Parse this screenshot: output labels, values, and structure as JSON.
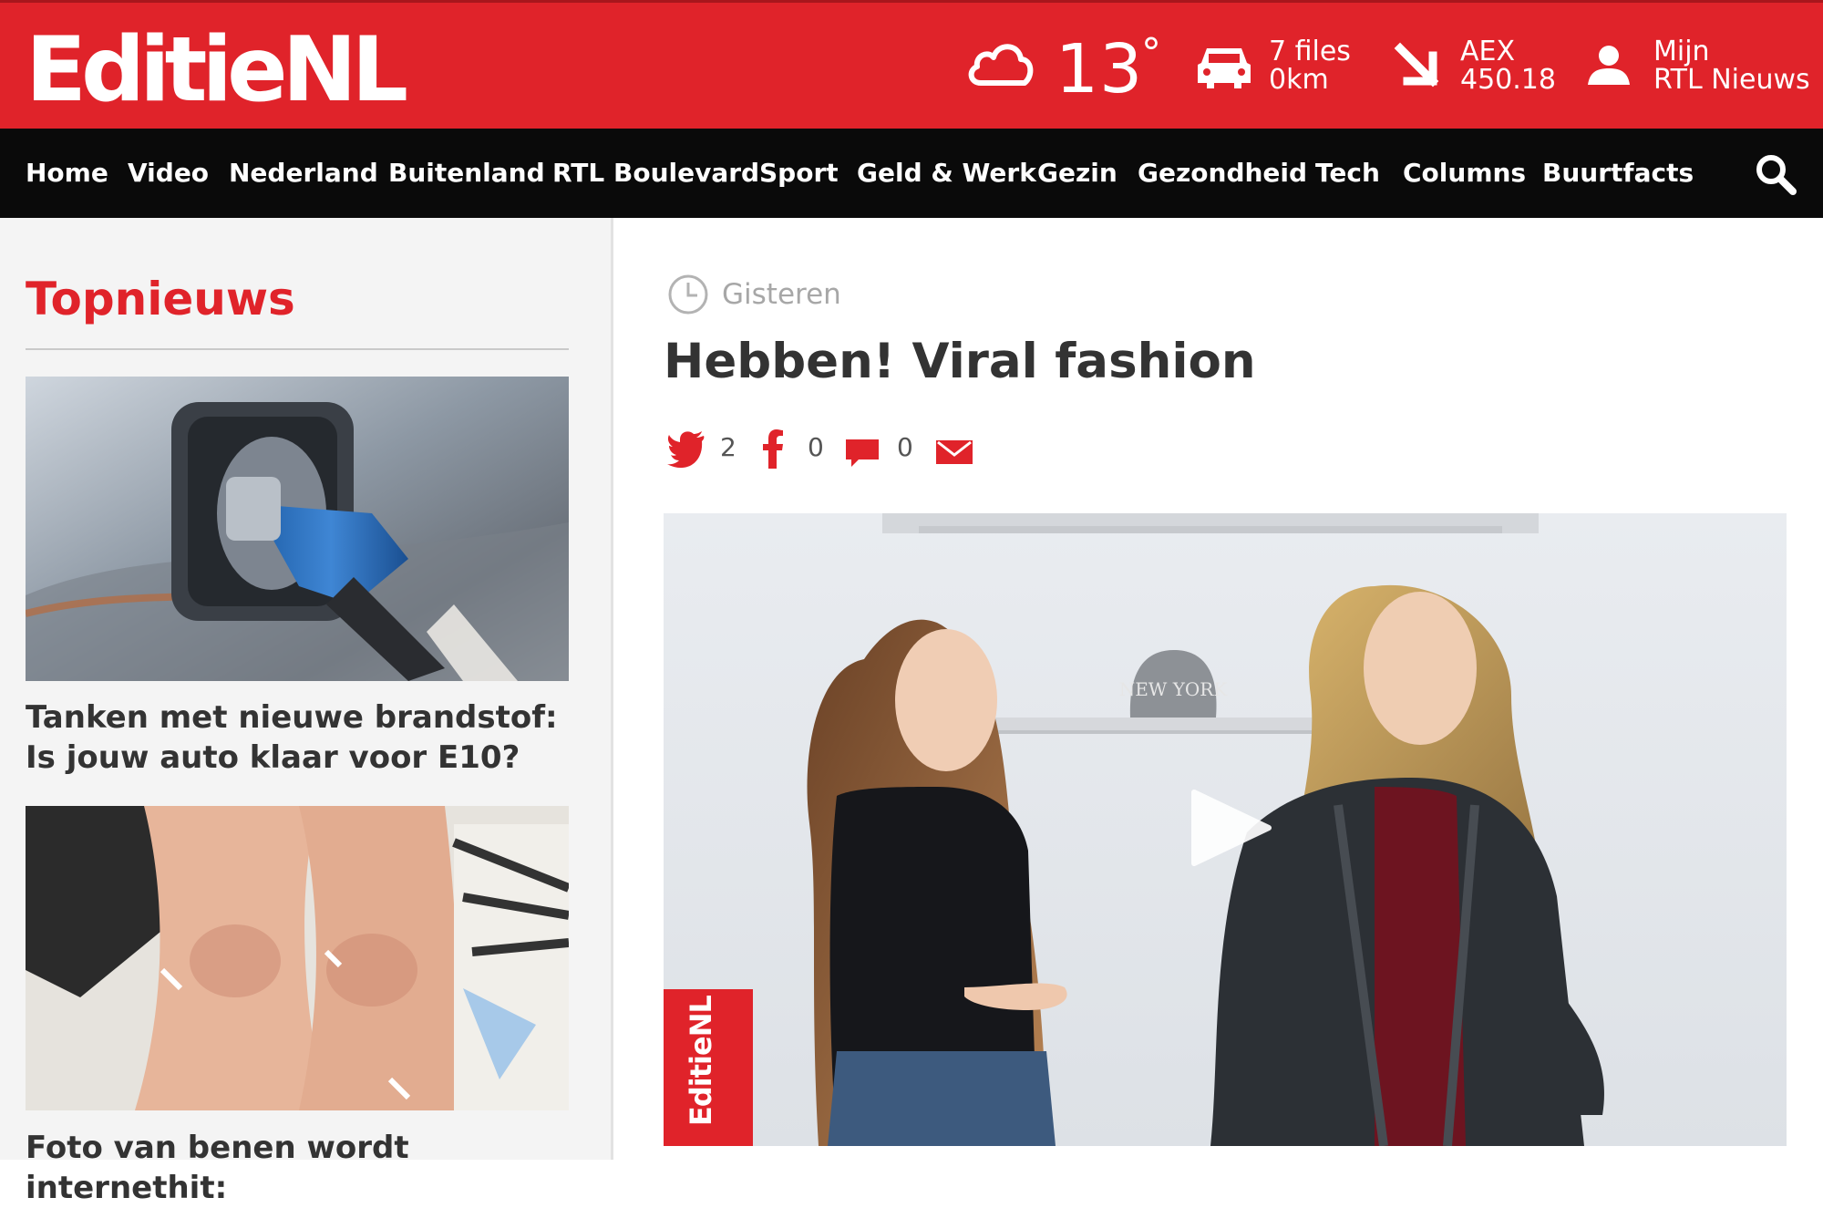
{
  "brand": {
    "logo_text": "EditieNL",
    "primary_color": "#e0232a",
    "nav_background": "#0a0a0a"
  },
  "header": {
    "weather": {
      "icon": "cloud-icon",
      "temperature": "13",
      "degree_symbol": "°"
    },
    "traffic": {
      "icon": "car-icon",
      "line1": "7 files",
      "line2": "0km"
    },
    "stocks": {
      "icon": "arrow-down-right-icon",
      "line1": "AEX",
      "line2": "450.18"
    },
    "account": {
      "icon": "user-icon",
      "line1": "Mijn",
      "line2": "RTL Nieuws"
    }
  },
  "nav": {
    "items": [
      "Home",
      "Video",
      "Nederland",
      "Buitenland",
      "RTL Boulevard",
      "Sport",
      "Geld & Werk",
      "Gezin",
      "Gezondheid",
      "Tech",
      "Columns",
      "Buurtfacts"
    ],
    "search_icon": "search-icon"
  },
  "sidebar": {
    "title": "Topnieuws",
    "stories": [
      {
        "title": "Tanken met nieuwe brandstof: Is jouw auto klaar voor E10?",
        "image": "fuel-nozzle-photo"
      },
      {
        "title": "Foto van benen wordt internethit:",
        "image": "legs-photo"
      }
    ]
  },
  "article": {
    "timestamp_icon": "clock-icon",
    "timestamp": "Gisteren",
    "headline": "Hebben! Viral fashion",
    "shares": {
      "twitter": {
        "icon": "twitter-icon",
        "count": "2"
      },
      "facebook": {
        "icon": "facebook-icon",
        "count": "0"
      },
      "comments": {
        "icon": "comment-icon",
        "count": "0"
      },
      "email": {
        "icon": "email-icon"
      }
    },
    "video": {
      "play_icon": "play-icon",
      "badge_text": "EditieNL",
      "cap_text": "NEW YORK"
    }
  }
}
